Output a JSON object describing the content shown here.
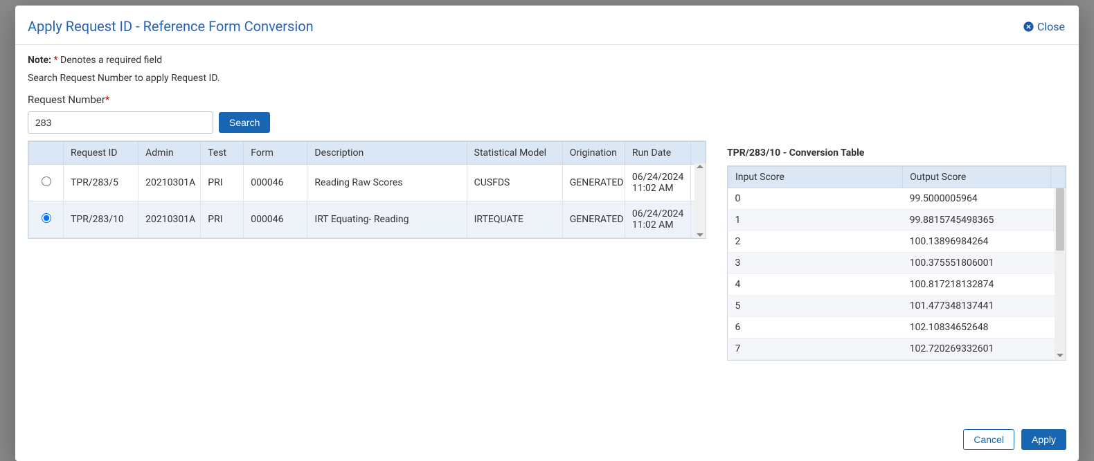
{
  "modal": {
    "title": "Apply Request ID - Reference Form Conversion",
    "close_label": "Close",
    "note_bold": "Note:",
    "note_text": " Denotes a required field",
    "instruction": "Search Request Number to apply Request ID.",
    "request_number_label": "Request Number",
    "request_number_value": "283",
    "search_btn": "Search",
    "cancel_btn": "Cancel",
    "apply_btn": "Apply"
  },
  "columns": {
    "request_id": "Request ID",
    "admin": "Admin",
    "test": "Test",
    "form": "Form",
    "description": "Description",
    "model": "Statistical Model",
    "origination": "Origination",
    "run_date": "Run Date"
  },
  "rows": [
    {
      "selected": false,
      "request_id": "TPR/283/5",
      "admin": "20210301A",
      "test": "PRI",
      "form": "000046",
      "description": "Reading Raw Scores",
      "model": "CUSFDS",
      "origination": "GENERATED",
      "run_date": "06/24/2024 11:02 AM"
    },
    {
      "selected": true,
      "request_id": "TPR/283/10",
      "admin": "20210301A",
      "test": "PRI",
      "form": "000046",
      "description": "IRT Equating- Reading",
      "model": "IRTEQUATE",
      "origination": "GENERATED",
      "run_date": "06/24/2024 11:02 AM"
    }
  ],
  "conversion": {
    "title": "TPR/283/10 - Conversion Table",
    "col_input": "Input Score",
    "col_output": "Output Score",
    "rows": [
      {
        "in": "0",
        "out": "99.5000005964"
      },
      {
        "in": "1",
        "out": "99.8815745498365"
      },
      {
        "in": "2",
        "out": "100.13896984264"
      },
      {
        "in": "3",
        "out": "100.375551806001"
      },
      {
        "in": "4",
        "out": "100.817218132874"
      },
      {
        "in": "5",
        "out": "101.477348137441"
      },
      {
        "in": "6",
        "out": "102.10834652648"
      },
      {
        "in": "7",
        "out": "102.720269332601"
      }
    ]
  }
}
